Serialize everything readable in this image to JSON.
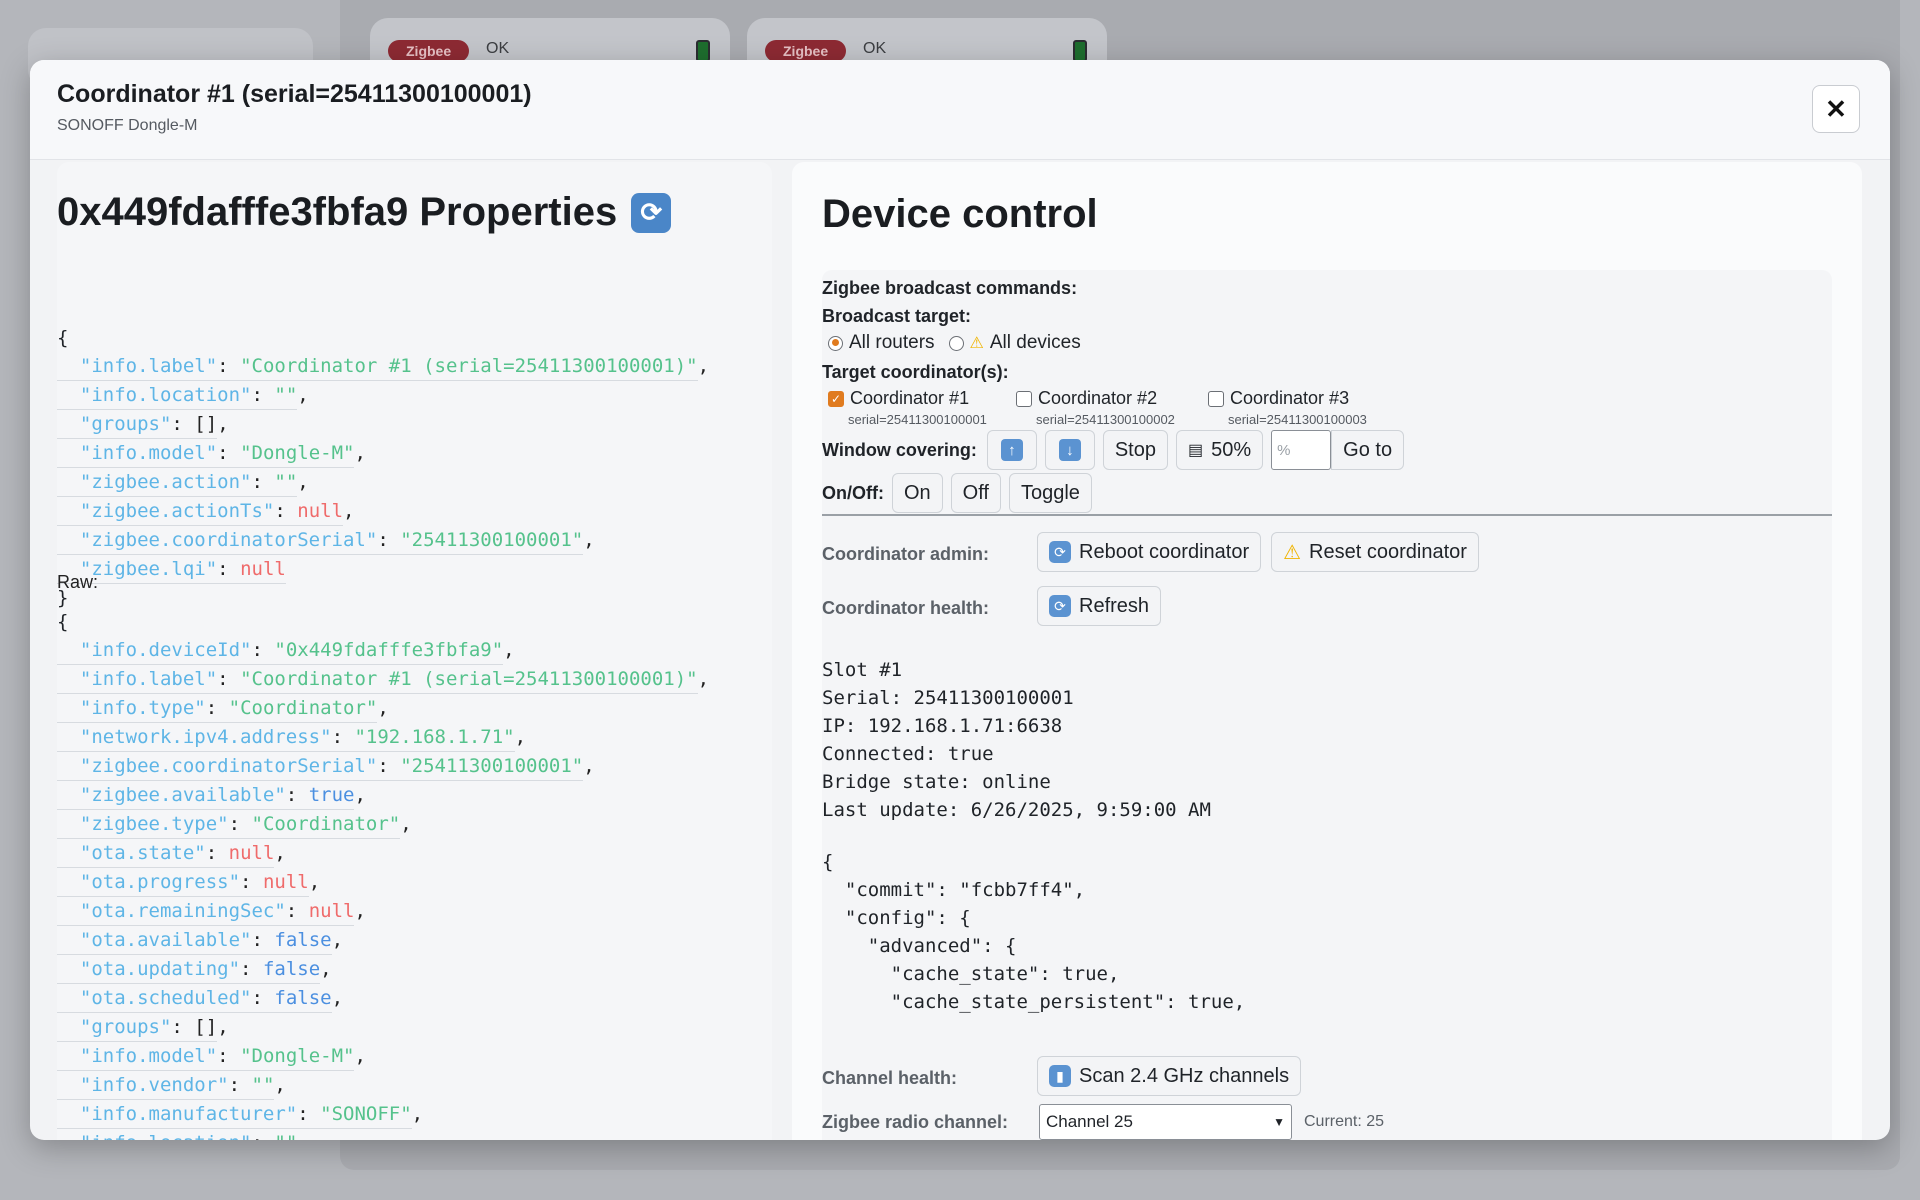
{
  "background": {
    "cards": [
      {
        "badge": "Zigbee",
        "status": "OK"
      },
      {
        "badge": "Zigbee",
        "status": "OK"
      }
    ]
  },
  "modal": {
    "title": "Coordinator #1 (serial=25411300100001)",
    "subtitle": "SONOFF Dongle-M",
    "close_label": "✕"
  },
  "properties": {
    "title": "0x449fdafffe3fbfa9 Properties",
    "raw_label": "Raw:",
    "open_brace": "{",
    "close_brace": "}",
    "lines": [
      {
        "key": "\"info.label\"",
        "value": "\"Coordinator #1 (serial=25411300100001)\"",
        "type": "s",
        "comma": true
      },
      {
        "key": "\"info.location\"",
        "value": "\"\"",
        "type": "s",
        "comma": true
      },
      {
        "key": "\"groups\"",
        "value": "[]",
        "type": "p",
        "comma": true
      },
      {
        "key": "\"info.model\"",
        "value": "\"Dongle-M\"",
        "type": "s",
        "comma": true
      },
      {
        "key": "\"zigbee.action\"",
        "value": "\"\"",
        "type": "s",
        "comma": true
      },
      {
        "key": "\"zigbee.actionTs\"",
        "value": "null",
        "type": "n",
        "comma": true
      },
      {
        "key": "\"zigbee.coordinatorSerial\"",
        "value": "\"25411300100001\"",
        "type": "s",
        "comma": true
      },
      {
        "key": "\"zigbee.lqi\"",
        "value": "null",
        "type": "n",
        "comma": false
      }
    ],
    "raw_lines": [
      {
        "key": "\"info.deviceId\"",
        "value": "\"0x449fdafffe3fbfa9\"",
        "type": "s",
        "comma": true
      },
      {
        "key": "\"info.label\"",
        "value": "\"Coordinator #1 (serial=25411300100001)\"",
        "type": "s",
        "comma": true
      },
      {
        "key": "\"info.type\"",
        "value": "\"Coordinator\"",
        "type": "s",
        "comma": true
      },
      {
        "key": "\"network.ipv4.address\"",
        "value": "\"192.168.1.71\"",
        "type": "s",
        "comma": true
      },
      {
        "key": "\"zigbee.coordinatorSerial\"",
        "value": "\"25411300100001\"",
        "type": "s",
        "comma": true
      },
      {
        "key": "\"zigbee.available\"",
        "value": "true",
        "type": "b",
        "comma": true
      },
      {
        "key": "\"zigbee.type\"",
        "value": "\"Coordinator\"",
        "type": "s",
        "comma": true
      },
      {
        "key": "\"ota.state\"",
        "value": "null",
        "type": "n",
        "comma": true
      },
      {
        "key": "\"ota.progress\"",
        "value": "null",
        "type": "n",
        "comma": true
      },
      {
        "key": "\"ota.remainingSec\"",
        "value": "null",
        "type": "n",
        "comma": true
      },
      {
        "key": "\"ota.available\"",
        "value": "false",
        "type": "b",
        "comma": true
      },
      {
        "key": "\"ota.updating\"",
        "value": "false",
        "type": "b",
        "comma": true
      },
      {
        "key": "\"ota.scheduled\"",
        "value": "false",
        "type": "b",
        "comma": true
      },
      {
        "key": "\"groups\"",
        "value": "[]",
        "type": "p",
        "comma": true
      },
      {
        "key": "\"info.model\"",
        "value": "\"Dongle-M\"",
        "type": "s",
        "comma": true
      },
      {
        "key": "\"info.vendor\"",
        "value": "\"\"",
        "type": "s",
        "comma": true
      },
      {
        "key": "\"info.manufacturer\"",
        "value": "\"SONOFF\"",
        "type": "s",
        "comma": true
      },
      {
        "key": "\"info.location\"",
        "value": "\"\"",
        "type": "s",
        "comma": true
      }
    ]
  },
  "device_control": {
    "title": "Device control",
    "broadcast_heading": "Zigbee broadcast commands:",
    "broadcast_target_label": "Broadcast target:",
    "targets": [
      {
        "label": "All routers",
        "selected": true,
        "warning": false
      },
      {
        "label": "All devices",
        "selected": false,
        "warning": true
      }
    ],
    "target_coordinators_label": "Target coordinator(s):",
    "coordinators": [
      {
        "label": "Coordinator #1",
        "serial": "serial=25411300100001",
        "checked": true
      },
      {
        "label": "Coordinator #2",
        "serial": "serial=25411300100002",
        "checked": false
      },
      {
        "label": "Coordinator #3",
        "serial": "serial=25411300100003",
        "checked": false
      }
    ],
    "window_covering_label": "Window covering:",
    "wc_stop": "Stop",
    "wc_half": "50%",
    "wc_placeholder": "%",
    "wc_goto": "Go to",
    "onoff_label": "On/Off:",
    "on": "On",
    "off": "Off",
    "toggle": "Toggle",
    "admin_label": "Coordinator admin:",
    "reboot": "Reboot coordinator",
    "reset": "Reset coordinator",
    "health_label": "Coordinator health:",
    "refresh": "Refresh",
    "health_text": "Slot #1\nSerial: 25411300100001\nIP: 192.168.1.71:6638\nConnected: true\nBridge state: online\nLast update: 6/26/2025, 9:59:00 AM",
    "config_json": "{\n  \"commit\": \"fcbb7ff4\",\n  \"config\": {\n    \"advanced\": {\n      \"cache_state\": true,\n      \"cache_state_persistent\": true,\n      \"cache_state_send_on_startup\": true,",
    "channel_health_label": "Channel health:",
    "scan": "Scan 2.4 GHz channels",
    "radio_channel_label": "Zigbee radio channel:",
    "channel_selected": "Channel 25",
    "current": "Current: 25"
  },
  "colors": {
    "accent": "#e07b1f",
    "string": "#55c28c",
    "null": "#ef6b6b",
    "bool": "#4b8fe0",
    "key": "#5eb5e6"
  }
}
